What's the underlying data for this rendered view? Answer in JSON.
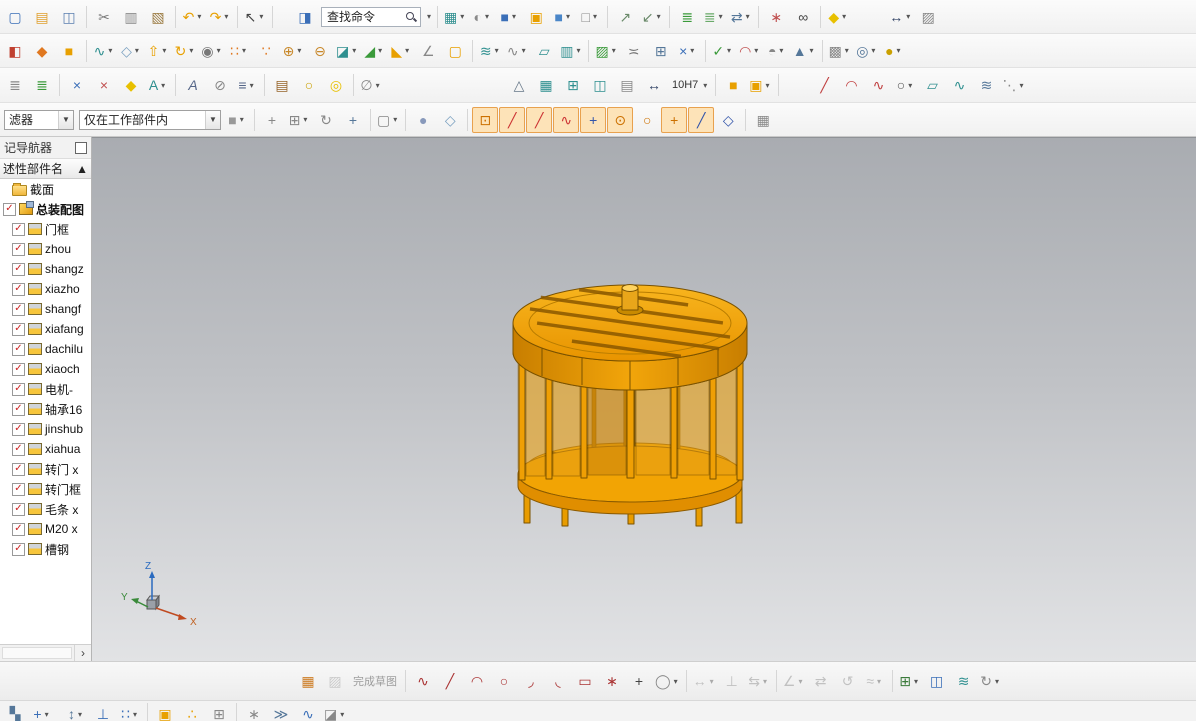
{
  "search": {
    "value": "查找命令"
  },
  "selection_bar": {
    "filter": "滤器",
    "scope": "仅在工作部件内"
  },
  "navigator": {
    "title": "记导航器",
    "column_header": "述性部件名",
    "items": [
      {
        "label": "截面",
        "icon": "folder",
        "checkbox": false,
        "indent": 1,
        "bold": false
      },
      {
        "label": "总装配图",
        "icon": "asm",
        "checkbox": true,
        "indent": 0,
        "bold": true
      },
      {
        "label": "门框",
        "icon": "part",
        "checkbox": true,
        "indent": 1,
        "bold": false
      },
      {
        "label": "zhou",
        "icon": "part",
        "checkbox": true,
        "indent": 1,
        "bold": false
      },
      {
        "label": "shangz",
        "icon": "part",
        "checkbox": true,
        "indent": 1,
        "bold": false
      },
      {
        "label": "xiazho",
        "icon": "part",
        "checkbox": true,
        "indent": 1,
        "bold": false
      },
      {
        "label": "shangf",
        "icon": "part",
        "checkbox": true,
        "indent": 1,
        "bold": false
      },
      {
        "label": "xiafang",
        "icon": "part",
        "checkbox": true,
        "indent": 1,
        "bold": false
      },
      {
        "label": "dachilu",
        "icon": "part",
        "checkbox": true,
        "indent": 1,
        "bold": false
      },
      {
        "label": "xiaoch",
        "icon": "part",
        "checkbox": true,
        "indent": 1,
        "bold": false
      },
      {
        "label": "电机-",
        "icon": "part",
        "checkbox": true,
        "indent": 1,
        "bold": false
      },
      {
        "label": "轴承16",
        "icon": "part",
        "checkbox": true,
        "indent": 1,
        "bold": false
      },
      {
        "label": "jinshub",
        "icon": "part",
        "checkbox": true,
        "indent": 1,
        "bold": false
      },
      {
        "label": "xiahua",
        "icon": "part",
        "checkbox": true,
        "indent": 1,
        "bold": false
      },
      {
        "label": "转门 x",
        "icon": "part",
        "checkbox": true,
        "indent": 1,
        "bold": false
      },
      {
        "label": "转门框",
        "icon": "part",
        "checkbox": true,
        "indent": 1,
        "bold": false
      },
      {
        "label": "毛条 x",
        "icon": "part",
        "checkbox": true,
        "indent": 1,
        "bold": false
      },
      {
        "label": "M20 x",
        "icon": "part",
        "checkbox": true,
        "indent": 1,
        "bold": false
      },
      {
        "label": "槽钢",
        "icon": "part",
        "checkbox": true,
        "indent": 1,
        "bold": false
      }
    ]
  },
  "triad": {
    "x": "X",
    "y": "Y",
    "z": "Z"
  },
  "model": {
    "name": "revolving-door-assembly",
    "primary_color": "#f0a000"
  },
  "toolbars": {
    "row1a": [
      {
        "n": "new-file-icon",
        "g": "▢",
        "c": "#3b6fb8"
      },
      {
        "n": "open-icon",
        "g": "▤",
        "c": "#e0a030"
      },
      {
        "n": "save-icon",
        "g": "◫",
        "c": "#5b7fb0"
      },
      {
        "sep": true
      },
      {
        "n": "cut-icon",
        "g": "✂",
        "c": "#777777"
      },
      {
        "n": "copy-icon",
        "g": "▥",
        "c": "#888888"
      },
      {
        "n": "paste-icon",
        "g": "▧",
        "c": "#9a7a40"
      },
      {
        "sep": true
      },
      {
        "n": "undo-icon",
        "g": "↶",
        "c": "#e8a000",
        "d": 1
      },
      {
        "n": "redo-icon",
        "g": "↷",
        "c": "#e8a000",
        "d": 1
      },
      {
        "sep": true
      },
      {
        "n": "selection-arrow-icon",
        "g": "↖",
        "c": "#444444",
        "d": 1
      },
      {
        "sep": true
      },
      {
        "gap": 14
      },
      {
        "n": "part-info-icon",
        "g": "◨",
        "c": "#3b6fb8"
      }
    ],
    "row1b": [
      {
        "sep": true
      },
      {
        "n": "window-layout-icon",
        "g": "▦",
        "c": "#2e8f8f",
        "d": 1
      },
      {
        "n": "display-mode-icon",
        "g": "◐",
        "c": "#8a8a8a",
        "d": 1
      },
      {
        "n": "show-hide-icon",
        "g": "■",
        "c": "#3b6fb8",
        "d": 1
      },
      {
        "n": "work-part-icon",
        "g": "▣",
        "c": "#e8a000"
      },
      {
        "n": "displayed-part-icon",
        "g": "■",
        "c": "#4a86c8",
        "d": 1
      },
      {
        "n": "window-icon",
        "g": "□",
        "c": "#8a8a8a",
        "d": 1
      },
      {
        "sep": true
      },
      {
        "n": "export-icon",
        "g": "↗",
        "c": "#6a8a6a"
      },
      {
        "n": "import-icon",
        "g": "↙",
        "c": "#6a8a6a",
        "d": 1
      },
      {
        "sep": true
      },
      {
        "n": "layer-settings-icon",
        "g": "≣",
        "c": "#3a9a3a"
      },
      {
        "n": "layer-visible-icon",
        "g": "≣",
        "c": "#6aaa6a",
        "d": 1
      },
      {
        "n": "move-to-layer-icon",
        "g": "⇄",
        "c": "#557799",
        "d": 1
      },
      {
        "sep": true
      },
      {
        "n": "visualization-icon",
        "g": "∗",
        "c": "#c05050"
      },
      {
        "n": "find-component-icon",
        "g": "∞",
        "c": "#444444"
      },
      {
        "sep": true
      },
      {
        "n": "material-icon",
        "g": "◆",
        "c": "#e8c000",
        "d": 1
      },
      {
        "gap": 34
      },
      {
        "n": "measure-icon",
        "g": "↔",
        "c": "#334466",
        "d": 1
      },
      {
        "n": "section-hatch-icon",
        "g": "▨",
        "c": "#888888"
      }
    ],
    "row2": [
      {
        "n": "part-family-icon",
        "g": "◧",
        "c": "#c04030"
      },
      {
        "n": "user-tool-icon",
        "g": "◆",
        "c": "#e07820"
      },
      {
        "n": "block-icon",
        "g": "■",
        "c": "#e8a000"
      },
      {
        "sep": true
      },
      {
        "n": "sketch-icon",
        "g": "∿",
        "c": "#2e8f8f",
        "d": 1
      },
      {
        "n": "datum-plane-icon",
        "g": "◇",
        "c": "#7aa0c0",
        "d": 1
      },
      {
        "n": "extrude-icon",
        "g": "⇧",
        "c": "#e8a000",
        "d": 1
      },
      {
        "n": "revolve-icon",
        "g": "↻",
        "c": "#e8a000",
        "d": 1
      },
      {
        "n": "hole-icon",
        "g": "◉",
        "c": "#777777",
        "d": 1
      },
      {
        "n": "pattern-feature-icon",
        "g": "∷",
        "c": "#e07820",
        "d": 1
      },
      {
        "n": "sphere-set-icon",
        "g": "∵",
        "c": "#e07820"
      },
      {
        "n": "unite-icon",
        "g": "⊕",
        "c": "#c8882a",
        "d": 1
      },
      {
        "n": "subtract-icon",
        "g": "⊖",
        "c": "#c8882a"
      },
      {
        "n": "trim-body-icon",
        "g": "◪",
        "c": "#2e8f8f",
        "d": 1
      },
      {
        "n": "edge-blend-icon",
        "g": "◢",
        "c": "#3a9a3a",
        "d": 1
      },
      {
        "n": "chamfer-icon",
        "g": "◣",
        "c": "#e8a000",
        "d": 1
      },
      {
        "n": "draft-icon",
        "g": "∠",
        "c": "#888888"
      },
      {
        "n": "shell-icon",
        "g": "▢",
        "c": "#e8a000"
      },
      {
        "sep": true
      },
      {
        "n": "through-curves-icon",
        "g": "≋",
        "c": "#2e8f8f",
        "d": 1
      },
      {
        "n": "swept-icon",
        "g": "∿",
        "c": "#888888",
        "d": 1
      },
      {
        "n": "ruled-surface-icon",
        "g": "▱",
        "c": "#2e8f8f"
      },
      {
        "n": "offset-surface-icon",
        "g": "▥",
        "c": "#2e8f8f",
        "d": 1
      },
      {
        "sep": true
      },
      {
        "n": "patch-icon",
        "g": "▨",
        "c": "#3a9a3a",
        "d": 1
      },
      {
        "n": "sew-icon",
        "g": "≍",
        "c": "#777777"
      },
      {
        "n": "thicken-icon",
        "g": "⊞",
        "c": "#557799"
      },
      {
        "n": "x-form-icon",
        "g": "×",
        "c": "#3b6fb8",
        "d": 1
      },
      {
        "sep": true
      },
      {
        "n": "examine-geometry-icon",
        "g": "✓",
        "c": "#3a9a3a",
        "d": 1
      },
      {
        "n": "curve-analysis-icon",
        "g": "◠",
        "c": "#c05050",
        "d": 1
      },
      {
        "n": "reflect-analysis-icon",
        "g": "◓",
        "c": "#888888",
        "d": 1
      },
      {
        "n": "draft-analysis-icon",
        "g": "▲",
        "c": "#557799",
        "d": 1
      },
      {
        "sep": true
      },
      {
        "n": "scene-settings-icon",
        "g": "▩",
        "c": "#888888",
        "d": 1
      },
      {
        "n": "render-style-icon",
        "g": "◎",
        "c": "#557799",
        "d": 1
      },
      {
        "n": "true-shading-icon",
        "g": "●",
        "c": "#caa000",
        "d": 1
      }
    ],
    "row3": [
      {
        "n": "sheet-list-icon",
        "g": "≣",
        "c": "#888888"
      },
      {
        "n": "layer-category-icon",
        "g": "≣",
        "c": "#3a9a3a"
      },
      {
        "sep": true
      },
      {
        "n": "move-face-icon",
        "g": "×",
        "c": "#3b6fb8"
      },
      {
        "n": "delete-face-icon",
        "g": "×",
        "c": "#c05050"
      },
      {
        "n": "datum-csys-icon",
        "g": "◆",
        "c": "#e8c000"
      },
      {
        "n": "text-icon",
        "g": "A",
        "c": "#2e8f8f",
        "d": 1
      },
      {
        "sep": true
      },
      {
        "n": "annotation-icon",
        "g": "A",
        "c": "#556688",
        "it": 1
      },
      {
        "n": "erase-icon",
        "g": "⊘",
        "c": "#888888"
      },
      {
        "n": "list-icon",
        "g": "≡",
        "c": "#556688",
        "d": 1
      },
      {
        "sep": true
      },
      {
        "n": "materials-icon",
        "g": "▤",
        "c": "#96642a"
      },
      {
        "n": "cylinder-icon",
        "g": "○",
        "c": "#caa000"
      },
      {
        "n": "washer-icon",
        "g": "◎",
        "c": "#e8c000"
      },
      {
        "sep": true
      },
      {
        "n": "no-selection-filter-icon",
        "g": "∅",
        "c": "#888888",
        "d": 1
      },
      {
        "gap": 120
      },
      {
        "n": "draft-triangle-icon",
        "g": "△",
        "c": "#667788"
      },
      {
        "n": "grid-icon",
        "g": "▦",
        "c": "#2e8f8f"
      },
      {
        "n": "dimension-grid-icon",
        "g": "⊞",
        "c": "#2e8f8f"
      },
      {
        "n": "frame-icon",
        "g": "◫",
        "c": "#2e8f8f"
      },
      {
        "n": "note-icon",
        "g": "▤",
        "c": "#888888"
      },
      {
        "n": "dimension-arrow-icon",
        "g": "↔",
        "c": "#334466"
      },
      {
        "n": "tolerance-dropdown",
        "t": "10H7",
        "d": 1
      },
      {
        "sep": true
      },
      {
        "n": "solid-cube-icon",
        "g": "■",
        "c": "#e8a000"
      },
      {
        "n": "cube-pair-icon",
        "g": "▣",
        "c": "#e8a000",
        "d": 1
      },
      {
        "sep": true
      },
      {
        "gap": 28
      },
      {
        "n": "line-curve-icon",
        "g": "╱",
        "c": "#c04040"
      },
      {
        "n": "arc-curve-icon",
        "g": "◠",
        "c": "#c04040"
      },
      {
        "n": "spline-curve-icon",
        "g": "∿",
        "c": "#c04040"
      },
      {
        "n": "loop-curve-icon",
        "g": "○",
        "c": "#555555",
        "d": 1
      },
      {
        "n": "surface-patch-icon",
        "g": "▱",
        "c": "#2e8f8f"
      },
      {
        "n": "curve-mesh-icon",
        "g": "∿",
        "c": "#2e8f8f"
      },
      {
        "n": "isoline-icon",
        "g": "≋",
        "c": "#557799"
      },
      {
        "n": "expand-more-icon",
        "g": "⋱",
        "c": "#888888",
        "d": 1
      }
    ],
    "row4": [
      {
        "n": "assembly-cube-icon",
        "g": "■",
        "c": "#999999",
        "d": 1
      },
      {
        "sep": true
      },
      {
        "n": "snap-options-icon",
        "g": "+",
        "c": "#888888"
      },
      {
        "n": "snap-handle-icon",
        "g": "⊞",
        "c": "#888888",
        "d": 1
      },
      {
        "n": "snap-rotate-icon",
        "g": "↻",
        "c": "#888888"
      },
      {
        "n": "snap-move-icon",
        "g": "+",
        "c": "#557799"
      },
      {
        "sep": true
      },
      {
        "n": "marquee-select-icon",
        "g": "▢",
        "c": "#888888",
        "d": 1
      },
      {
        "sep": true
      },
      {
        "n": "shaded-sphere-icon",
        "g": "●",
        "c": "#8899bb"
      },
      {
        "n": "wireframe-cube-icon",
        "g": "◇",
        "c": "#7aa0c0"
      },
      {
        "sep": true
      },
      {
        "n": "enable-snap-icon",
        "g": "⊡",
        "c": "#cc7000",
        "pressed": 1
      },
      {
        "n": "endpoint-snap-icon",
        "g": "╱",
        "c": "#cc3333",
        "pressed": 1
      },
      {
        "n": "midpoint-snap-icon",
        "g": "╱",
        "c": "#cc3333",
        "pressed": 1
      },
      {
        "n": "control-point-snap-icon",
        "g": "∿",
        "c": "#cc3333",
        "pressed": 1
      },
      {
        "n": "intersection-snap-icon",
        "g": "+",
        "c": "#3355aa",
        "pressed": 1
      },
      {
        "n": "arc-center-snap-icon",
        "g": "⊙",
        "c": "#cc7000",
        "pressed": 1
      },
      {
        "n": "quadrant-snap-icon",
        "g": "○",
        "c": "#cc7000"
      },
      {
        "n": "existing-point-snap-icon",
        "g": "+",
        "c": "#cc7000",
        "pressed": 1
      },
      {
        "n": "point-on-curve-snap-icon",
        "g": "╱",
        "c": "#3355aa",
        "pressed": 1
      },
      {
        "n": "point-on-surface-snap-icon",
        "g": "◇",
        "c": "#3355aa"
      },
      {
        "sep": true
      },
      {
        "n": "grid-snap-icon",
        "g": "▦",
        "c": "#888888"
      }
    ],
    "sketch": [
      {
        "n": "sketch-preferences-icon",
        "g": "▦",
        "c": "#cc7a20"
      },
      {
        "n": "finish-flag-icon",
        "g": "▨",
        "c": "#999999",
        "dis": 1
      },
      {
        "n": "finish-sketch-label",
        "t": "完成草图",
        "dis": 1
      },
      {
        "sep": true
      },
      {
        "n": "profile-icon",
        "g": "∿",
        "c": "#aa3333"
      },
      {
        "n": "line-icon",
        "g": "╱",
        "c": "#aa3333"
      },
      {
        "n": "arc-icon",
        "g": "◠",
        "c": "#aa3333"
      },
      {
        "n": "circle-icon",
        "g": "○",
        "c": "#aa3333"
      },
      {
        "n": "fillet-icon",
        "g": "◞",
        "c": "#aa3333"
      },
      {
        "n": "trim-curve-icon",
        "g": "◟",
        "c": "#aa3333"
      },
      {
        "n": "rectangle-icon",
        "g": "▭",
        "c": "#aa3333"
      },
      {
        "n": "polygon-icon",
        "g": "∗",
        "c": "#aa3333"
      },
      {
        "n": "point-icon",
        "g": "+",
        "c": "#444444"
      },
      {
        "n": "ellipse-icon",
        "g": "◯",
        "c": "#888888",
        "d": 1
      },
      {
        "sep": true
      },
      {
        "n": "rapid-dimension-icon",
        "g": "↔",
        "c": "#888888",
        "dis": 1,
        "d": 1
      },
      {
        "n": "geometric-constraints-icon",
        "g": "⊥",
        "c": "#888888",
        "dis": 1
      },
      {
        "n": "make-symmetric-icon",
        "g": "⇆",
        "c": "#888888",
        "dis": 1,
        "d": 1
      },
      {
        "sep": true
      },
      {
        "n": "display-constraints-icon",
        "g": "∠",
        "c": "#888888",
        "dis": 1,
        "d": 1
      },
      {
        "n": "convert-reference-icon",
        "g": "⇄",
        "c": "#888888",
        "dis": 1
      },
      {
        "n": "alternate-solution-icon",
        "g": "↺",
        "c": "#888888",
        "dis": 1
      },
      {
        "n": "inferred-constraints-icon",
        "g": "≈",
        "c": "#888888",
        "dis": 1,
        "d": 1
      },
      {
        "sep": true
      },
      {
        "n": "pattern-curve-icon",
        "g": "⊞",
        "c": "#3a7a3a",
        "d": 1
      },
      {
        "n": "mirror-curve-icon",
        "g": "◫",
        "c": "#3b6fb8"
      },
      {
        "n": "offset-curve-icon",
        "g": "≋",
        "c": "#2e8f8f"
      },
      {
        "n": "more-curve-icon",
        "g": "↻",
        "c": "#888888",
        "d": 1
      }
    ],
    "bottom": [
      {
        "n": "assembly-view-icon",
        "g": "▚",
        "c": "#557799"
      },
      {
        "n": "add-component-icon",
        "g": "+",
        "c": "#3b6fb8",
        "d": 1
      },
      {
        "gap": 6
      },
      {
        "n": "move-component-icon",
        "g": "↕",
        "c": "#557799",
        "d": 1
      },
      {
        "n": "assembly-constraints-icon",
        "g": "⊥",
        "c": "#3b6fb8"
      },
      {
        "n": "pattern-component-icon",
        "g": "∷",
        "c": "#3b6fb8",
        "d": 1
      },
      {
        "sep": true
      },
      {
        "n": "cube-stack-icon",
        "g": "▣",
        "c": "#e8a000"
      },
      {
        "n": "sphere-group-icon",
        "g": "∴",
        "c": "#e8a000"
      },
      {
        "n": "corner-cube-icon",
        "g": "⊞",
        "c": "#888888"
      },
      {
        "sep": true
      },
      {
        "n": "exploded-view-icon",
        "g": "∗",
        "c": "#888888"
      },
      {
        "n": "sequence-icon",
        "g": "≫",
        "c": "#557799"
      },
      {
        "n": "wave-link-icon",
        "g": "∿",
        "c": "#3b6fb8"
      },
      {
        "n": "assembly-cut-icon",
        "g": "◪",
        "c": "#888888",
        "d": 1
      }
    ]
  }
}
